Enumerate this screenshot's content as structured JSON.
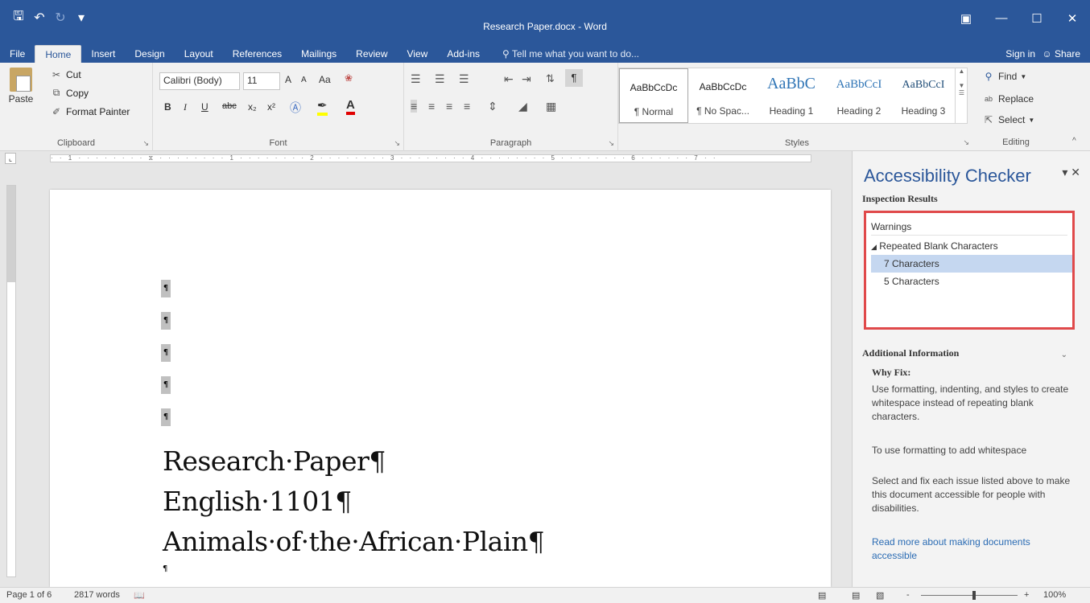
{
  "window": {
    "title": "Research Paper.docx - Word",
    "qat": {
      "save_icon": "save-icon",
      "undo_icon": "undo-icon",
      "redo_icon": "redo-icon",
      "customize_icon": "customize-qat-icon"
    }
  },
  "tabs": [
    "File",
    "Home",
    "Insert",
    "Design",
    "Layout",
    "References",
    "Mailings",
    "Review",
    "View",
    "Add-ins"
  ],
  "tell_me": "Tell me what you want to do...",
  "sign_in": "Sign in",
  "share": "Share",
  "ribbon": {
    "clipboard": {
      "label": "Clipboard",
      "paste": "Paste",
      "cut": "Cut",
      "copy": "Copy",
      "format_painter": "Format Painter"
    },
    "font": {
      "label": "Font",
      "font_name": "Calibri (Body)",
      "font_size": "11",
      "grow": "A",
      "shrink": "A",
      "case": "Aa",
      "bold": "B",
      "italic": "I",
      "underline": "U",
      "strike": "abc",
      "sub": "x₂",
      "sup": "x²"
    },
    "paragraph": {
      "label": "Paragraph"
    },
    "styles": {
      "label": "Styles",
      "items": [
        {
          "preview": "AaBbCcDc",
          "name": "¶ Normal"
        },
        {
          "preview": "AaBbCcDc",
          "name": "¶ No Spac..."
        },
        {
          "preview": "AaBbC",
          "name": "Heading 1"
        },
        {
          "preview": "AaBbCcI",
          "name": "Heading 2"
        },
        {
          "preview": "AaBbCcI",
          "name": "Heading 3"
        }
      ]
    },
    "editing": {
      "label": "Editing",
      "find": "Find",
      "replace": "Replace",
      "select": "Select"
    }
  },
  "document": {
    "lines": [
      "Research·Paper¶",
      "English·1101¶",
      "Animals·of·the·African·Plain¶"
    ],
    "pilcrow": "¶"
  },
  "pane": {
    "title": "Accessibility Checker",
    "inspection_results": "Inspection Results",
    "warnings": "Warnings",
    "group": "Repeated Blank Characters",
    "items": [
      "7 Characters",
      "5 Characters"
    ],
    "additional_information": "Additional Information",
    "why_fix": "Why Fix:",
    "why_fix_text": "Use formatting, indenting, and styles to create whitespace instead of repeating blank characters.",
    "how_to_fix": "To use formatting to add whitespace",
    "select_text": "Select and fix each issue listed above to make this document accessible for people with disabilities.",
    "read_more": "Read more about making documents accessible"
  },
  "status": {
    "page": "Page 1 of 6",
    "words": "2817 words",
    "zoom": "100%",
    "zoom_minus": "-",
    "zoom_plus": "+"
  }
}
